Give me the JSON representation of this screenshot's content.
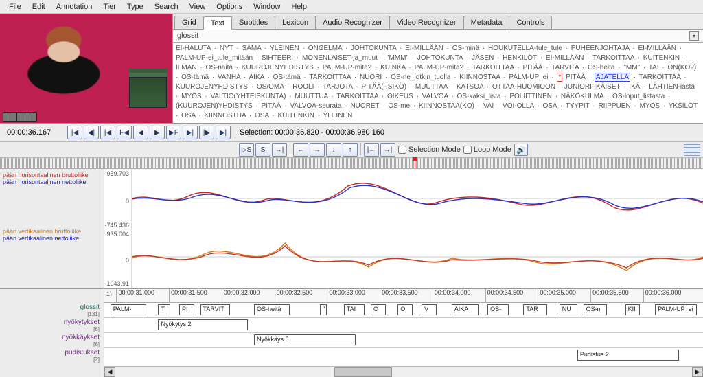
{
  "menu": [
    "File",
    "Edit",
    "Annotation",
    "Tier",
    "Type",
    "Search",
    "View",
    "Options",
    "Window",
    "Help"
  ],
  "videoTime": "00:00:36.167",
  "tabs": [
    "Grid",
    "Text",
    "Subtitles",
    "Lexicon",
    "Audio Recognizer",
    "Video Recognizer",
    "Metadata",
    "Controls"
  ],
  "activeTab": "Text",
  "glossTierName": "glossit",
  "glossText": "EI-HALUTA · NYT · SAMA · YLEINEN · ONGELMA · JOHTOKUNTA · EI-MILLÄÄN · OS-minä · HOUKUTELLA-tule_tule · PUHEENJOHTAJA · EI-MILLÄÄN · PALM-UP-ei_tule_mitään · SIHTEERI · MONENLAISET-ja_muut · \"MMM\" · JOHTOKUNTA · JÄSEN · HENKILÖT · EI-MILLÄÄN · TARKOITTAA · KUITENKIN · ILMAN · OS-näitä · KUUROJENYHDISTYS · PALM-UP-mitä? · KUINKA · PALM-UP-mitä? · TARKOITTAA · PITÄÄ · TARVITA · OS-heitä · \"MM\" · TAI · ON(KO?) · OS-tämä · VANHA · AIKA · OS-tämä · TARKOITTAA · NUORI · OS-ne_jotkin_tuolla · KIINNOSTAA · PALM-UP_ei · ",
  "glossHighlightRed": "*",
  "glossHighlightBetween": " PITÄÄ · ",
  "glossHighlightBlue": "AJATELLA",
  "glossTextAfter": " · TARKOITTAA · KUUROJENYHDISTYS · OS/OMA · ROOLI · TARJOTA · PITÄÄ(-ISIKÖ) · MUUTTAA · KATSOA · OTTAA-HUOMIOON · JUNIORI-IKÄISET · IKÄ · LÄHTIEN-iästä · MYÖS · VALTIO(YHTEISKUNTA) · MUUTTUA · TARKOITTAA · OIKEUS · VALVOA · OS-kaksi_lista · POLIITTINEN · NÄKÖKULMA · OS-loput_listasta · (KUUROJEN)YHDISTYS · PITÄÄ · VALVOA-seurata · NUORET · OS-me · KIINNOSTAA(KO) · VAI · VOI-OLLA · OSA · TYYPIT · RIIPPUEN · MYÖS · YKSILÖT · OSA · KIINNOSTUA · OSA · KUITENKIN · YLEINEN",
  "selectionText": "Selection: 00:00:36.820 - 00:00:36.980   160",
  "playBtns1": [
    "|◀",
    "◀|",
    "|◀",
    "F◀",
    "◀",
    "▶",
    "▶F",
    "▶|",
    "|▶",
    "▶|"
  ],
  "playBtns2": [
    "▷S",
    "S",
    "→|",
    "",
    "←",
    "→",
    "↓",
    "↑",
    "",
    "|←",
    "→|"
  ],
  "selectionMode": "Selection Mode",
  "loopMode": "Loop Mode",
  "waveLabels": {
    "block1": {
      "a": "pään horisontaalinen bruttoliike",
      "b": "pään horisontaalinen nettoliike"
    },
    "block2": {
      "a": "pään vertikaalinen bruttoliike",
      "b": "pään vertikaalinen nettoliike"
    }
  },
  "axis1": {
    "top": "959.703",
    "mid": "0",
    "bot": "-745.436"
  },
  "axis2": {
    "top": "935.004",
    "mid": "0",
    "bot": "-1043.91"
  },
  "rulerStart": "1)",
  "rulerTicks": [
    "00:00:31.000",
    "00:00:31.500",
    "00:00:32.000",
    "00:00:32.500",
    "00:00:33.000",
    "00:00:33.500",
    "00:00:34.000",
    "00:00:34.500",
    "00:00:35.000",
    "00:00:35.500",
    "00:00:36.000"
  ],
  "tierNames": {
    "glossit": {
      "name": "glossit",
      "count": "[131]"
    },
    "nyokytykset": {
      "name": "nyökytykset",
      "count": "[6]"
    },
    "nyokkaykset": {
      "name": "nyökkäykset",
      "count": "[6]"
    },
    "pudistukset": {
      "name": "pudistukset",
      "count": "[2]"
    }
  },
  "glossSegs": [
    {
      "l": 1,
      "w": 6,
      "t": "PALM-"
    },
    {
      "l": 9,
      "w": 2,
      "t": "T"
    },
    {
      "l": 12.5,
      "w": 2.5,
      "t": "PI"
    },
    {
      "l": 16,
      "w": 5,
      "t": "TARVIT"
    },
    {
      "l": 25,
      "w": 6,
      "t": "OS-heitä"
    },
    {
      "l": 36,
      "w": 1.2,
      "t": "\""
    },
    {
      "l": 40,
      "w": 3.5,
      "t": "TAI"
    },
    {
      "l": 44.5,
      "w": 2.5,
      "t": "O"
    },
    {
      "l": 49,
      "w": 2.5,
      "t": "O"
    },
    {
      "l": 53,
      "w": 2.5,
      "t": "V"
    },
    {
      "l": 58,
      "w": 4.5,
      "t": "AIKA"
    },
    {
      "l": 64,
      "w": 3.5,
      "t": "OS-"
    },
    {
      "l": 70,
      "w": 4,
      "t": "TAR"
    },
    {
      "l": 76,
      "w": 3,
      "t": "NU"
    },
    {
      "l": 80,
      "w": 4,
      "t": "OS-n"
    },
    {
      "l": 87,
      "w": 2.5,
      "t": "KII"
    },
    {
      "l": 92,
      "w": 7,
      "t": "PALM-UP_ei"
    }
  ],
  "nyokytys": {
    "l": 9,
    "w": 15,
    "t": "Nyökytys 2"
  },
  "nyokkays": {
    "l": 25,
    "w": 17,
    "t": "Nyökkäys 5"
  },
  "pudistus": {
    "l": 79,
    "w": 17,
    "t": "Pudistus 2"
  }
}
